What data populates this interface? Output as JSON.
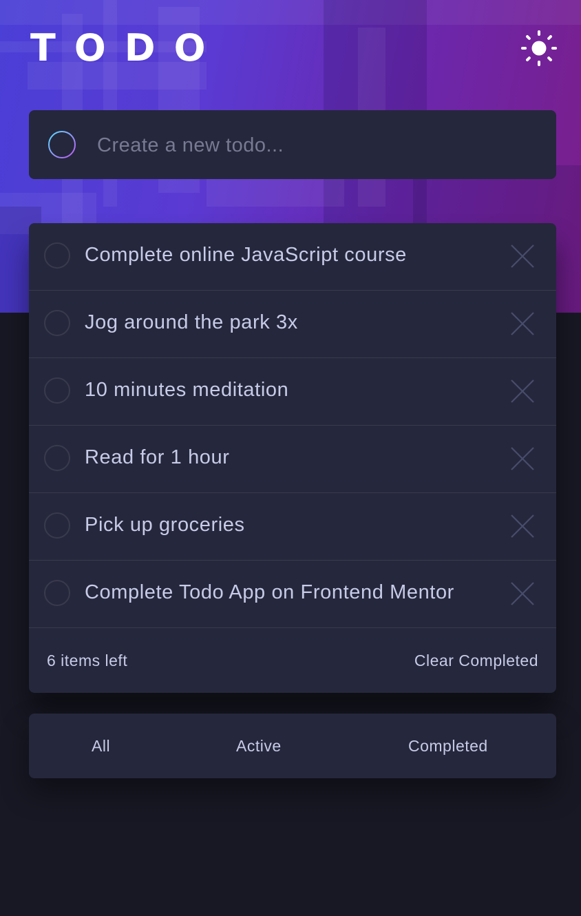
{
  "header": {
    "title": "TODO",
    "theme_icon": "sun-icon"
  },
  "new_todo": {
    "placeholder": "Create a new todo...",
    "value": ""
  },
  "todos": [
    {
      "text": "Complete online JavaScript course",
      "completed": false
    },
    {
      "text": "Jog around the park 3x",
      "completed": false
    },
    {
      "text": "10 minutes meditation",
      "completed": false
    },
    {
      "text": "Read for 1 hour",
      "completed": false
    },
    {
      "text": "Pick up groceries",
      "completed": false
    },
    {
      "text": "Complete Todo App on Frontend Mentor",
      "completed": false
    }
  ],
  "footer": {
    "items_left": "6 items left",
    "clear_label": "Clear Completed"
  },
  "filters": {
    "all": "All",
    "active": "Active",
    "completed": "Completed",
    "selected": "all"
  },
  "colors": {
    "background": "#181824",
    "card": "#25273c",
    "text": "#c8cbe7",
    "placeholder": "#777a92",
    "divider": "#393a4c",
    "gradient_start": "#57ddff",
    "gradient_end": "#c058f3"
  }
}
